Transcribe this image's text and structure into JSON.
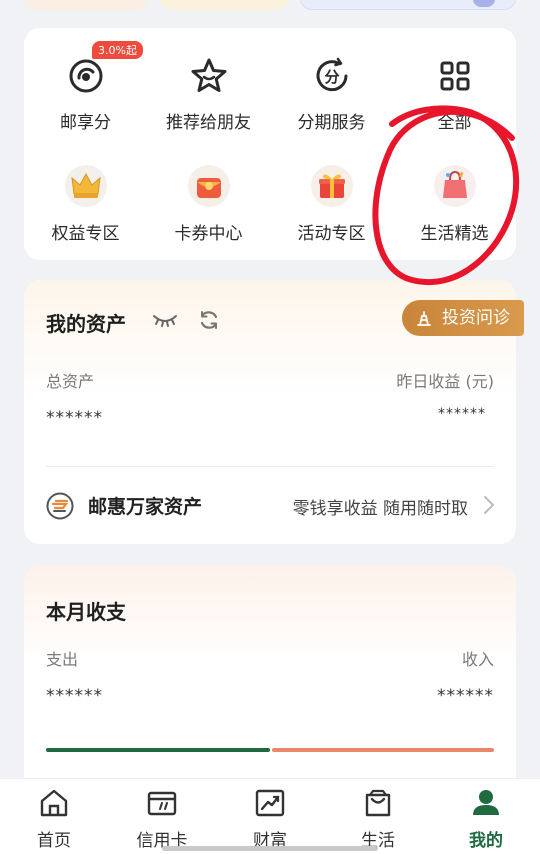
{
  "services": {
    "row1": [
      {
        "label": "邮享分",
        "icon": "points-icon",
        "badge": "3.0%起"
      },
      {
        "label": "推荐给朋友",
        "icon": "star-icon"
      },
      {
        "label": "分期服务",
        "icon": "installment-icon"
      },
      {
        "label": "全部",
        "icon": "grid-icon"
      }
    ],
    "row2": [
      {
        "label": "权益专区",
        "icon": "crown-icon"
      },
      {
        "label": "卡券中心",
        "icon": "coupon-icon"
      },
      {
        "label": "活动专区",
        "icon": "gift-icon"
      },
      {
        "label": "生活精选",
        "icon": "shopping-bag-icon"
      }
    ]
  },
  "assets": {
    "title": "我的资产",
    "diagnosis_button": "投资问诊",
    "total_label": "总资产",
    "total_value": "******",
    "yesterday_label": "昨日收益 (元)",
    "yesterday_value": "******",
    "promo_title": "邮惠万家资产",
    "promo_sub": "零钱享收益 随用随时取"
  },
  "monthly": {
    "title": "本月收支",
    "expense_label": "支出",
    "expense_value": "******",
    "income_label": "收入",
    "income_value": "******",
    "expense_share": 0.5,
    "colors": {
      "expense": "#1f6b3f",
      "income": "#e9876a"
    }
  },
  "tabbar": [
    {
      "label": "首页",
      "icon": "home-icon"
    },
    {
      "label": "信用卡",
      "icon": "credit-card-icon"
    },
    {
      "label": "财富",
      "icon": "wealth-chart-icon"
    },
    {
      "label": "生活",
      "icon": "shopping-bag-icon"
    },
    {
      "label": "我的",
      "icon": "profile-icon",
      "active": true
    }
  ],
  "colors": {
    "accent": "#1f6b3f",
    "annotation": "#e8162c",
    "badge": "#ee4a3d"
  }
}
